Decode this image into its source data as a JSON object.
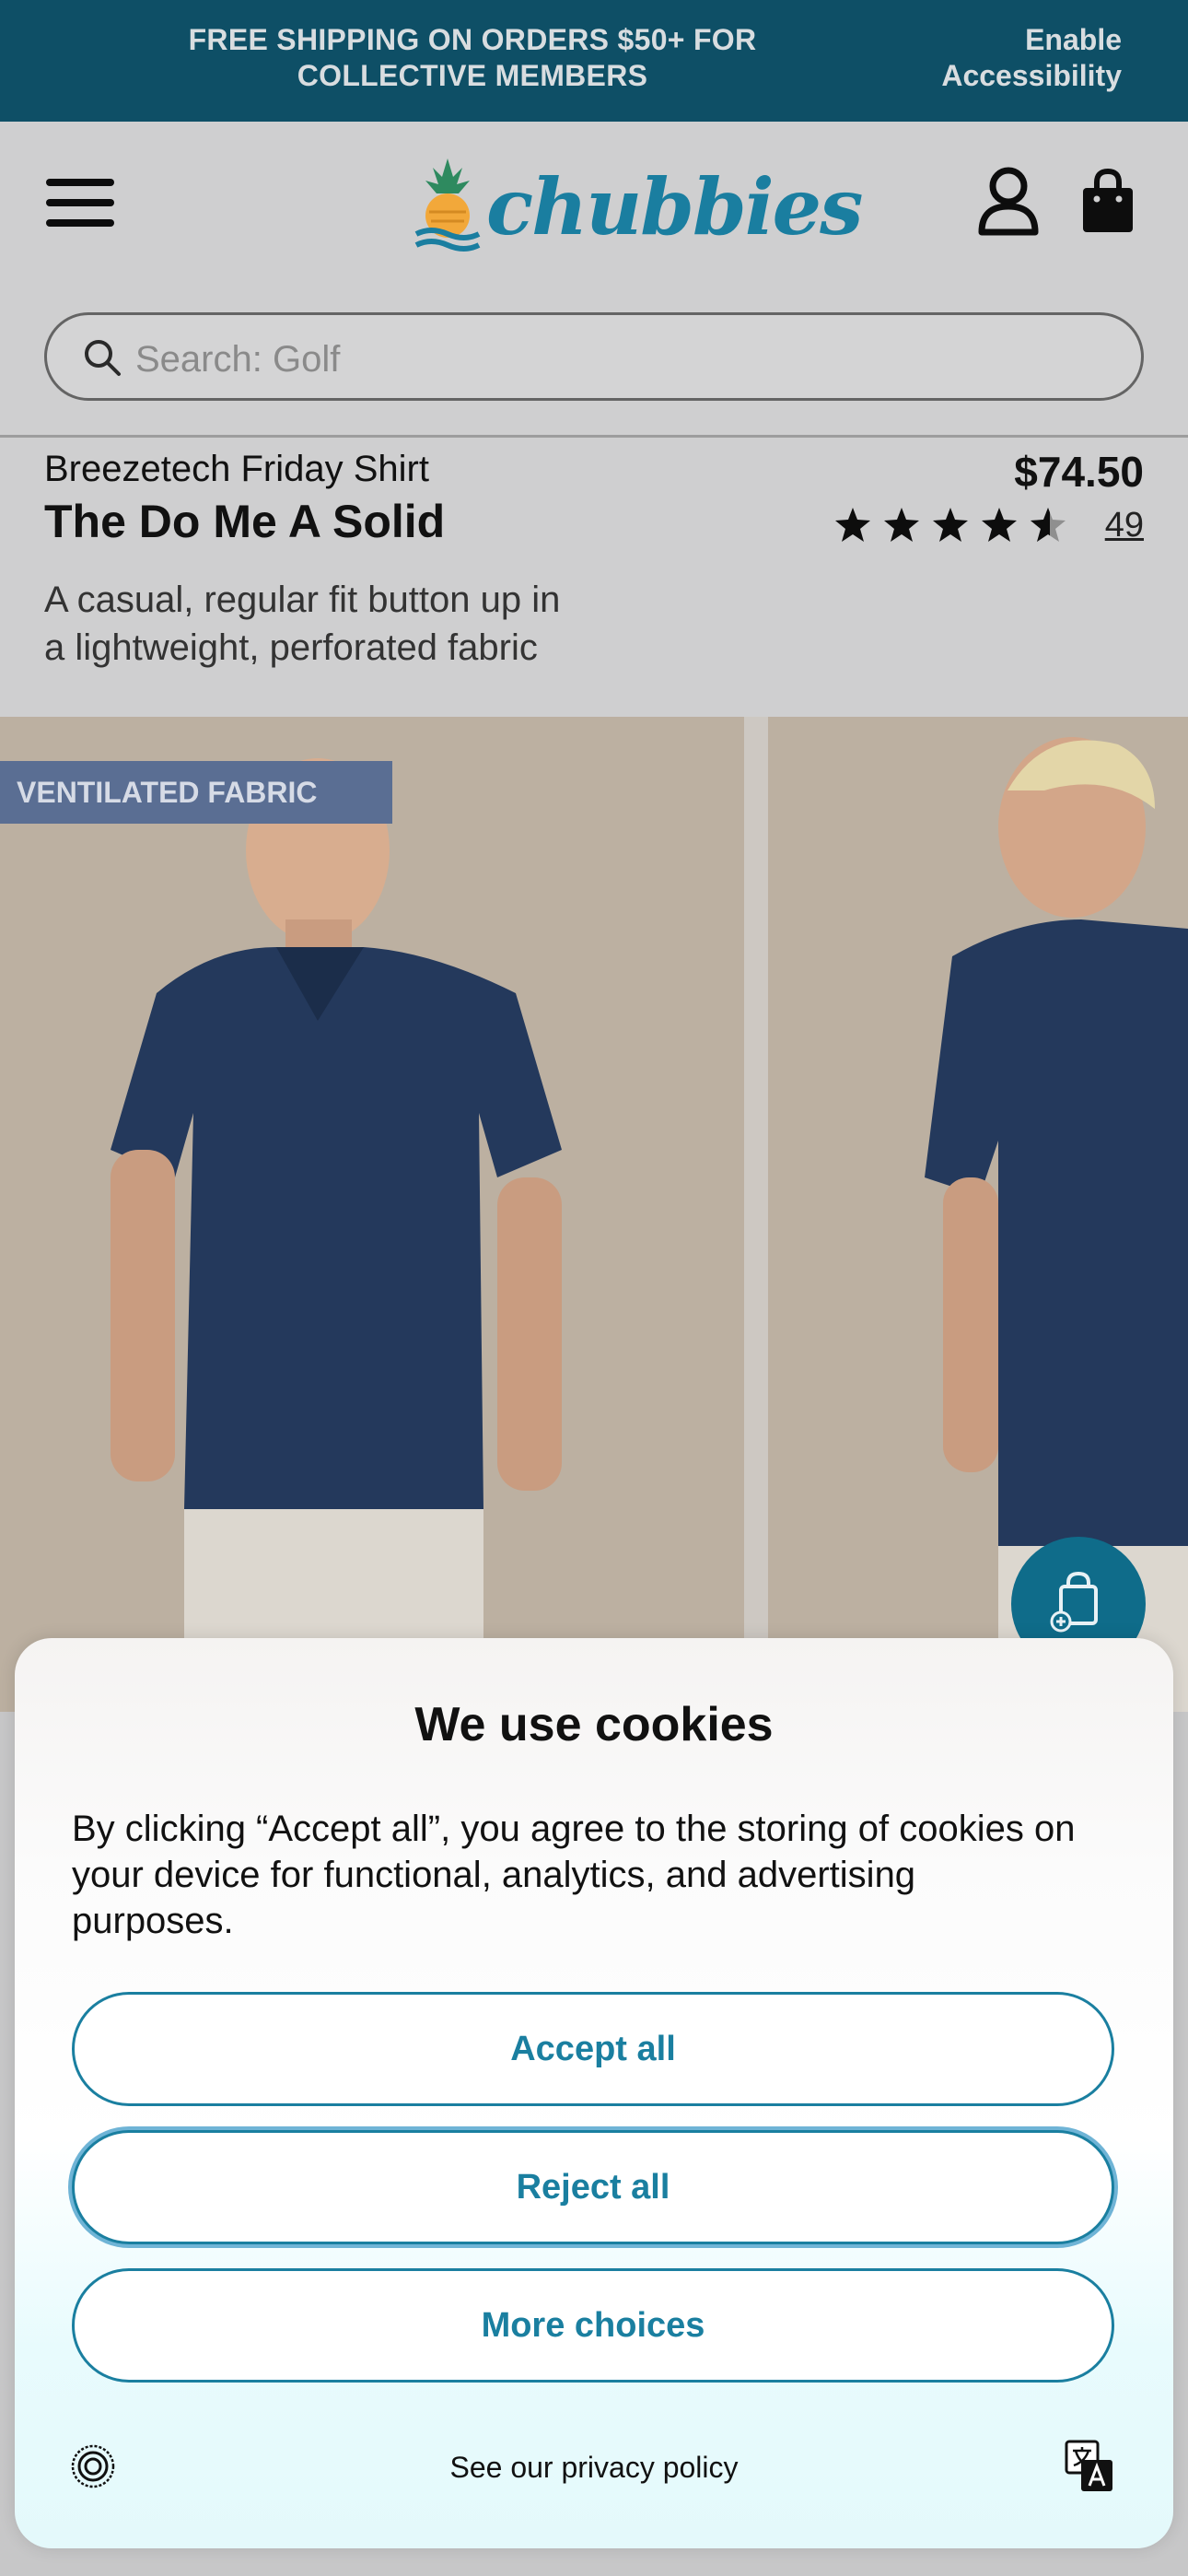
{
  "topbar": {
    "promo_line1": "FREE SHIPPING ON ORDERS $50+ FOR",
    "promo_line2": "COLLECTIVE MEMBERS",
    "accessibility_line1": "Enable",
    "accessibility_line2": "Accessibility",
    "background": "#0e4f66"
  },
  "header": {
    "brand": "chubbies",
    "search_placeholder": "Search: Golf",
    "icons": [
      "menu-icon",
      "pineapple-logo",
      "account-icon",
      "shopping-bag-icon",
      "search-icon"
    ]
  },
  "product": {
    "collection": "Breezetech Friday Shirt",
    "name": "The Do Me A Solid",
    "price": "$74.50",
    "rating": 4.5,
    "review_count": "49",
    "description_line1": "A casual, regular fit button up in",
    "description_line2": "a lightweight, perforated fabric",
    "badge": "VENTILATED FABRIC"
  },
  "cookie_banner": {
    "title": "We use cookies",
    "body": "By clicking “Accept all”, you agree to the storing of cookies on your device for functional, analytics, and advertising purposes.",
    "accept_label": "Accept all",
    "reject_label": "Reject all",
    "more_label": "More choices",
    "privacy_label": "See our privacy policy",
    "accent": "#1a7fa0"
  }
}
